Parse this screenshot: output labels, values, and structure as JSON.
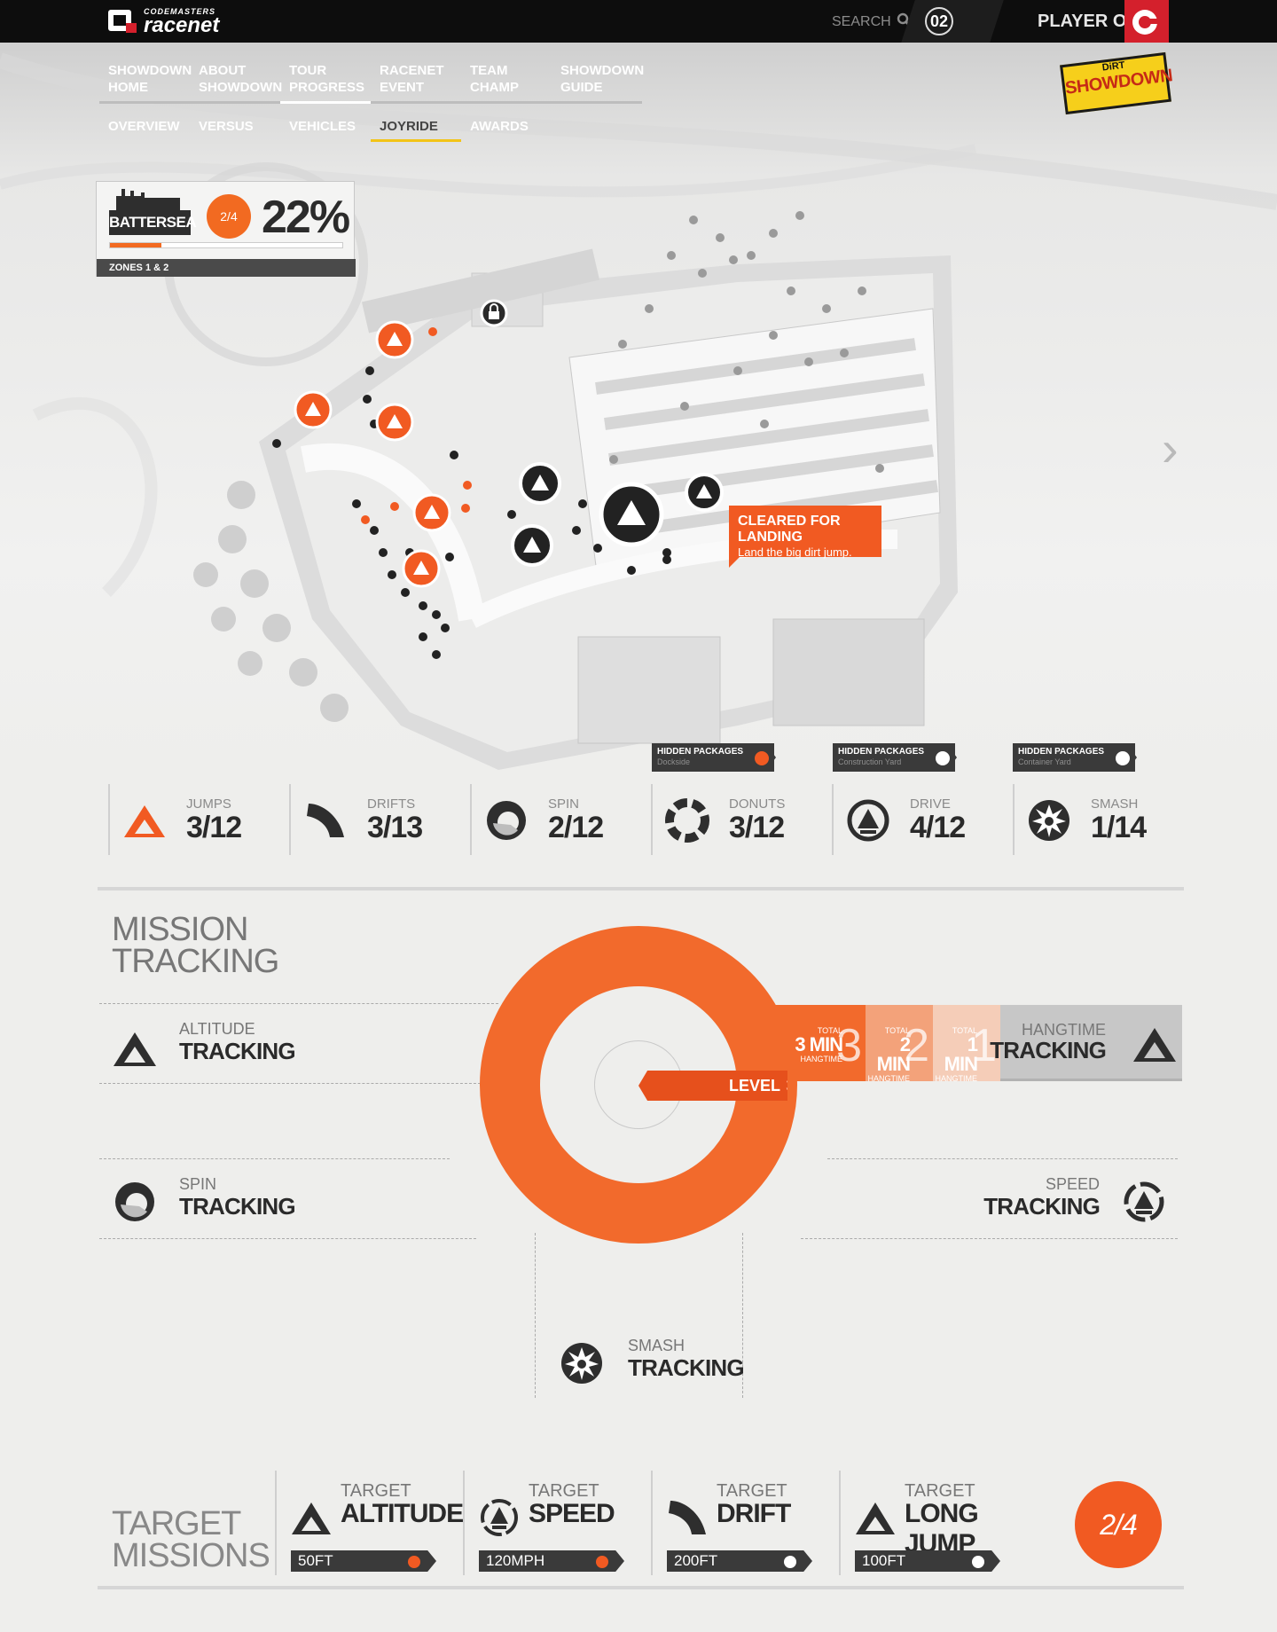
{
  "header": {
    "brand_small": "CODEMASTERS",
    "brand_big": "racenet",
    "search_label": "SEARCH",
    "level_badge": "02",
    "player_name": "PLAYER ONE"
  },
  "nav": {
    "primary": [
      {
        "line1": "SHOWDOWN",
        "line2": "HOME"
      },
      {
        "line1": "ABOUT",
        "line2": "SHOWDOWN"
      },
      {
        "line1": "TOUR",
        "line2": "PROGRESS"
      },
      {
        "line1": "RACENET",
        "line2": "EVENT"
      },
      {
        "line1": "TEAM",
        "line2": "CHAMP"
      },
      {
        "line1": "SHOWDOWN",
        "line2": "GUIDE"
      }
    ],
    "secondary": [
      "OVERVIEW",
      "VERSUS",
      "VEHICLES",
      "JOYRIDE",
      "AWARDS"
    ],
    "game_logo_top": "DiRT",
    "game_logo_bottom": "SHOWDOWN"
  },
  "location": {
    "name": "BATTERSEA",
    "count": "2/4",
    "percent": "22%",
    "progress": 0.22,
    "zones": "ZONES 1 & 2"
  },
  "callout": {
    "title": "CLEARED FOR LANDING",
    "subtitle": "Land the big dirt jump."
  },
  "stats": [
    {
      "label": "JUMPS",
      "value": "3/12",
      "icon": "jump-icon"
    },
    {
      "label": "DRIFTS",
      "value": "3/13",
      "icon": "drift-icon"
    },
    {
      "label": "SPIN",
      "value": "2/12",
      "icon": "spin-icon"
    },
    {
      "label": "DONUTS",
      "value": "3/12",
      "icon": "donut-icon"
    },
    {
      "label": "DRIVE",
      "value": "4/12",
      "icon": "drive-icon"
    },
    {
      "label": "SMASH",
      "value": "1/14",
      "icon": "smash-icon"
    }
  ],
  "hidden_packages": [
    {
      "title": "HIDDEN PACKAGES",
      "area": "Dockside",
      "found": true
    },
    {
      "title": "HIDDEN PACKAGES",
      "area": "Construction Yard",
      "found": false
    },
    {
      "title": "HIDDEN PACKAGES",
      "area": "Container Yard",
      "found": false
    }
  ],
  "mission_tracking": {
    "title_line1": "MISSION",
    "title_line2": "TRACKING",
    "altitude": {
      "sub": "ALTITUDE",
      "main": "TRACKING"
    },
    "spin": {
      "sub": "SPIN",
      "main": "TRACKING"
    },
    "speed": {
      "sub": "SPEED",
      "main": "TRACKING"
    },
    "smash": {
      "sub": "SMASH",
      "main": "TRACKING"
    },
    "hangtime": {
      "sub": "HANGTIME",
      "main": "TRACKING"
    },
    "level_label": "LEVEL",
    "level_value": "3",
    "hangtime_levels": [
      {
        "total": "TOTAL",
        "time": "3 MIN",
        "caption": "HANGTIME",
        "level": "3",
        "color": "#f26a2c"
      },
      {
        "total": "TOTAL",
        "time": "2 MIN",
        "caption": "HANGTIME",
        "level": "2",
        "color": "#f3a27a"
      },
      {
        "total": "TOTAL",
        "time": "1 MIN",
        "caption": "HANGTIME",
        "level": "1",
        "color": "#f5cdb8"
      }
    ]
  },
  "target_missions": {
    "title_line1": "TARGET",
    "title_line2": "MISSIONS",
    "items": [
      {
        "target": "TARGET",
        "name": "ALTITUDE",
        "value": "50FT",
        "done": true
      },
      {
        "target": "TARGET",
        "name": "SPEED",
        "value": "120MPH",
        "done": true
      },
      {
        "target": "TARGET",
        "name": "DRIFT",
        "value": "200FT",
        "done": false
      },
      {
        "target": "TARGET",
        "name": "LONG JUMP",
        "value": "100FT",
        "done": false
      }
    ],
    "progress": "2/4"
  },
  "colors": {
    "accent": "#f15a22",
    "dark": "#2b2b2b",
    "nav_active_underline": "#f2c417"
  }
}
